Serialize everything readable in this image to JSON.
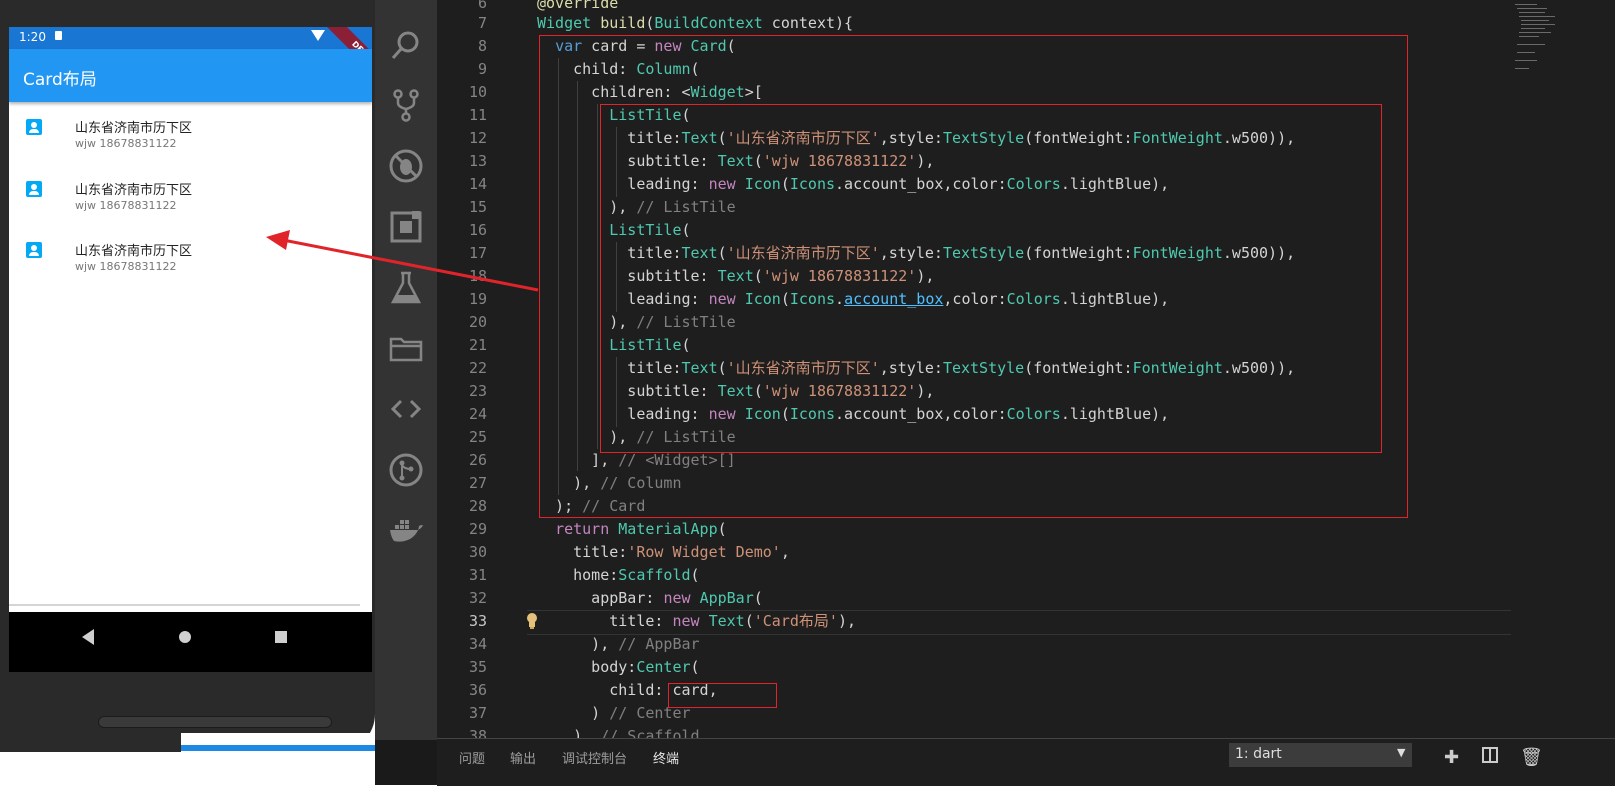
{
  "phone": {
    "status_time": "1:20",
    "debug_badge": "DEBUG",
    "app_title": "Card布局",
    "list_items": [
      {
        "title": "山东省济南市历下区",
        "subtitle": "wjw 18678831122"
      },
      {
        "title": "山东省济南市历下区",
        "subtitle": "wjw 18678831122"
      },
      {
        "title": "山东省济南市历下区",
        "subtitle": "wjw 18678831122"
      }
    ]
  },
  "activity_bar": [
    "search-icon",
    "source-control-icon",
    "debug-icon",
    "extensions-icon",
    "test-flask-icon",
    "explorer-folder-icon",
    "code-icon",
    "git-branch-icon",
    "docker-icon"
  ],
  "editor": {
    "lines": [
      {
        "n": "6",
        "c": "@override"
      },
      {
        "n": "7",
        "c": "Widget build(BuildContext context){"
      },
      {
        "n": "8",
        "c": "var card = new Card("
      },
      {
        "n": "9",
        "c": "child: Column("
      },
      {
        "n": "10",
        "c": "children: <Widget>["
      },
      {
        "n": "11",
        "c": "ListTile("
      },
      {
        "n": "12",
        "c": "title:Text('山东省济南市历下区',style:TextStyle(fontWeight:FontWeight.w500)),"
      },
      {
        "n": "13",
        "c": "subtitle: Text('wjw 18678831122'),"
      },
      {
        "n": "14",
        "c": "leading: new Icon(Icons.account_box,color:Colors.lightBlue),"
      },
      {
        "n": "15",
        "c": "), // ListTile"
      },
      {
        "n": "16",
        "c": "ListTile("
      },
      {
        "n": "17",
        "c": "title:Text('山东省济南市历下区',style:TextStyle(fontWeight:FontWeight.w500)),"
      },
      {
        "n": "18",
        "c": "subtitle: Text('wjw 18678831122'),"
      },
      {
        "n": "19",
        "c": "leading: new Icon(Icons.account_box,color:Colors.lightBlue),"
      },
      {
        "n": "20",
        "c": "), // ListTile"
      },
      {
        "n": "21",
        "c": "ListTile("
      },
      {
        "n": "22",
        "c": "title:Text('山东省济南市历下区',style:TextStyle(fontWeight:FontWeight.w500)),"
      },
      {
        "n": "23",
        "c": "subtitle: Text('wjw 18678831122'),"
      },
      {
        "n": "24",
        "c": "leading: new Icon(Icons.account_box,color:Colors.lightBlue),"
      },
      {
        "n": "25",
        "c": "), // ListTile"
      },
      {
        "n": "26",
        "c": "], // <Widget>[]"
      },
      {
        "n": "27",
        "c": "), // Column"
      },
      {
        "n": "28",
        "c": "); // Card"
      },
      {
        "n": "29",
        "c": "return MaterialApp("
      },
      {
        "n": "30",
        "c": "title:'Row Widget Demo',"
      },
      {
        "n": "31",
        "c": "home:Scaffold("
      },
      {
        "n": "32",
        "c": "appBar: new AppBar("
      },
      {
        "n": "33",
        "c": "title: new Text('Card布局'),"
      },
      {
        "n": "34",
        "c": "), // AppBar"
      },
      {
        "n": "35",
        "c": "body:Center("
      },
      {
        "n": "36",
        "c": "child: card,"
      },
      {
        "n": "37",
        "c": ") // Center"
      },
      {
        "n": "38",
        "c": "), // Scaffold"
      }
    ]
  },
  "panel": {
    "tabs": [
      "问题",
      "输出",
      "调试控制台",
      "终端"
    ],
    "active_tab": "终端",
    "terminal_select": "1: dart"
  },
  "colors": {
    "keyword": "#c586c0",
    "type": "#4ec9b0",
    "string": "#ce9178",
    "comment": "#6a9955",
    "highlight_box": "#e0242a",
    "appbar": "#2196f3",
    "icon": "#03a9f4"
  }
}
